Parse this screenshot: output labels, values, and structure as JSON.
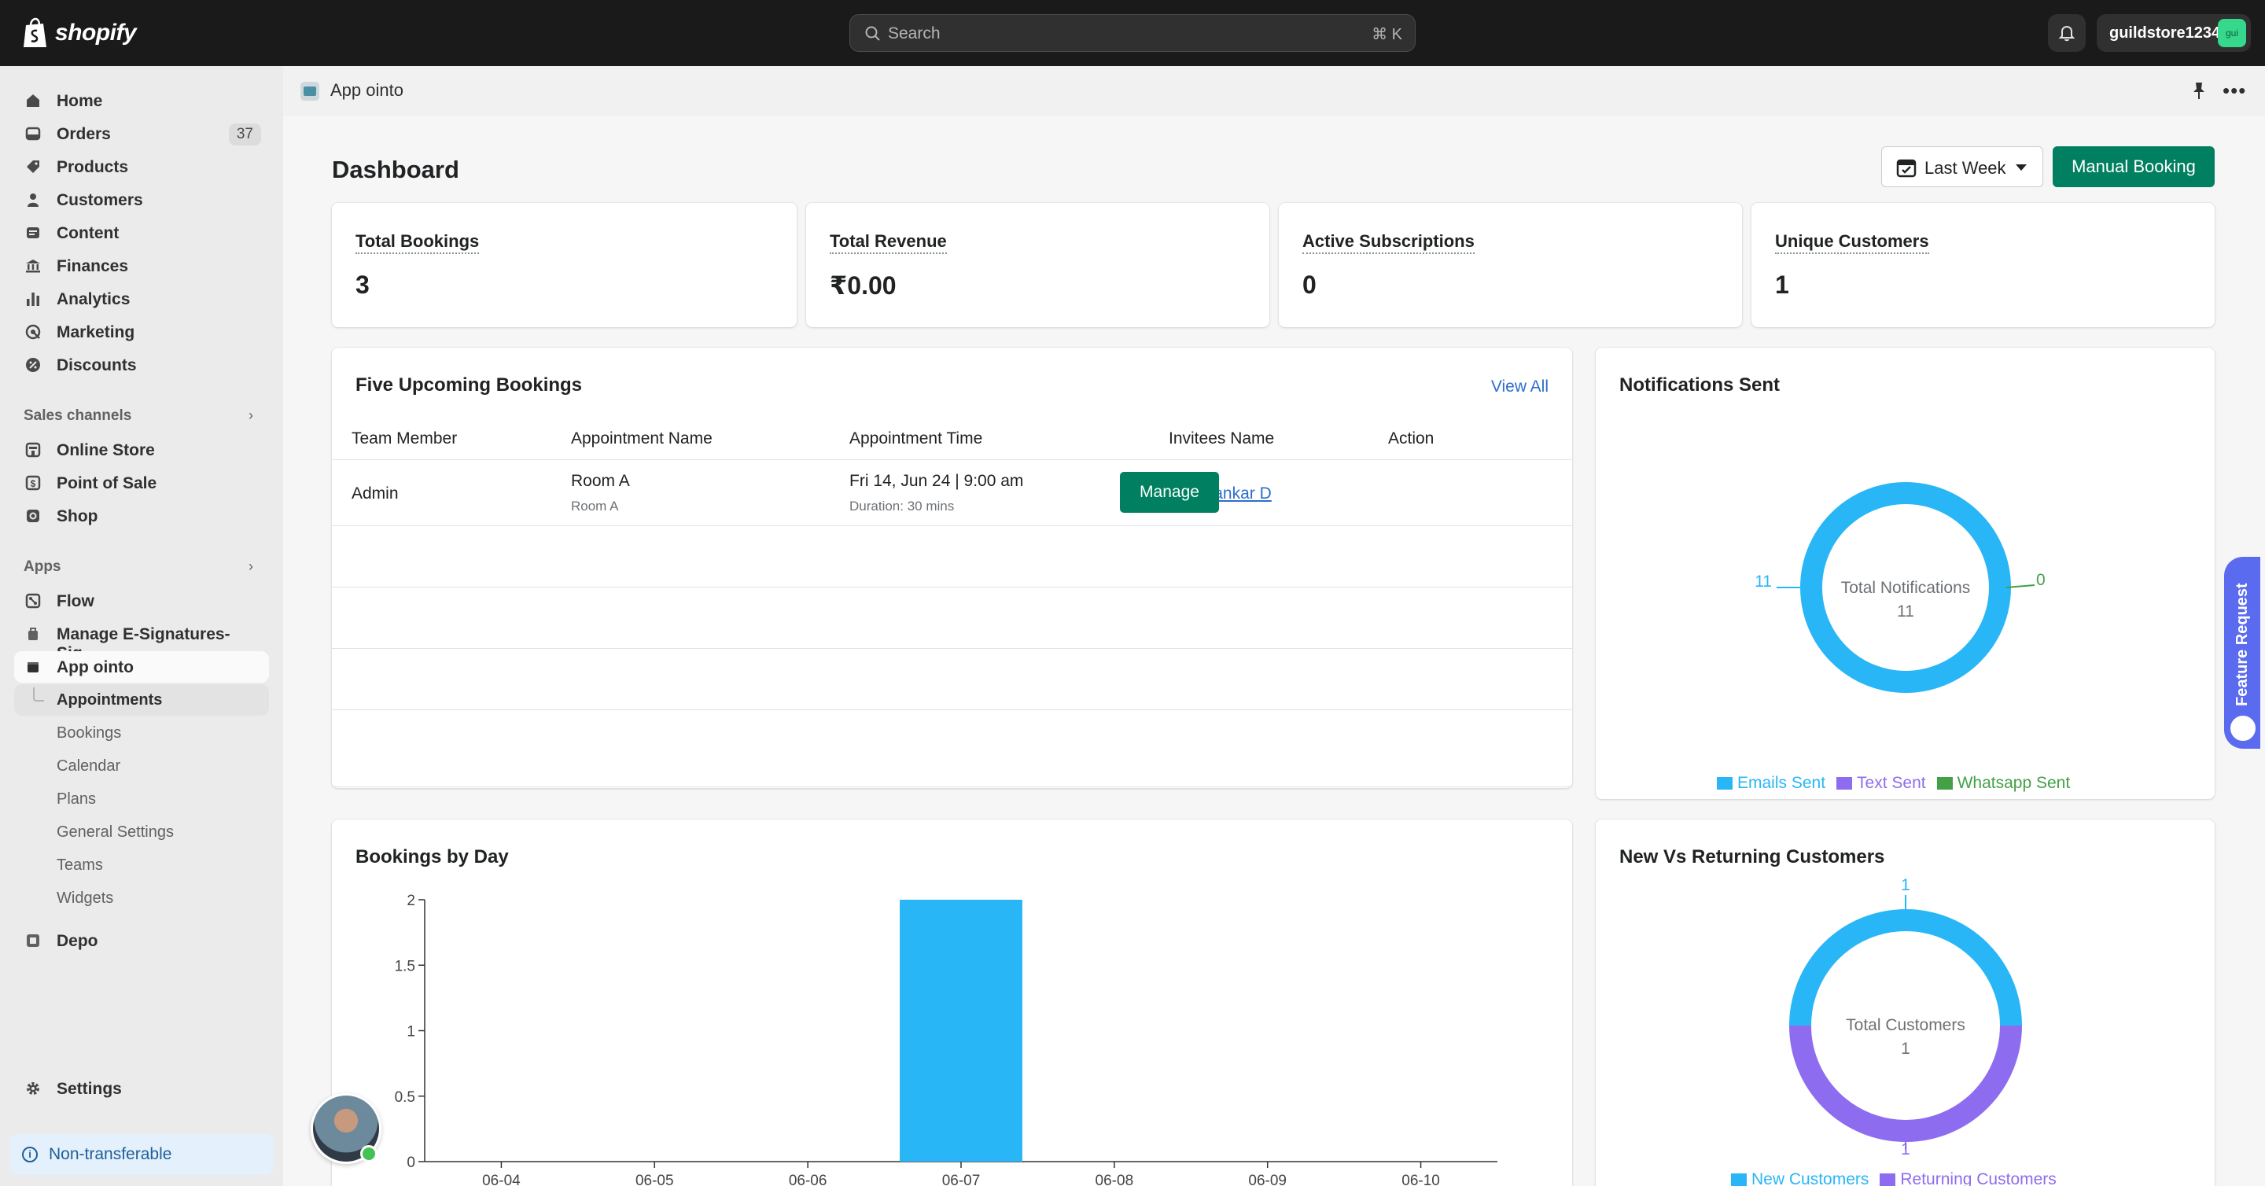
{
  "topbar": {
    "brand": "shopify",
    "search_placeholder": "Search",
    "search_shortcut": "⌘ K",
    "store_name": "guildstore1234",
    "store_avatar": "gui"
  },
  "sidebar": {
    "items": [
      {
        "label": "Home"
      },
      {
        "label": "Orders",
        "badge": "37"
      },
      {
        "label": "Products"
      },
      {
        "label": "Customers"
      },
      {
        "label": "Content"
      },
      {
        "label": "Finances"
      },
      {
        "label": "Analytics"
      },
      {
        "label": "Marketing"
      },
      {
        "label": "Discounts"
      }
    ],
    "sales_channels_label": "Sales channels",
    "channels": [
      {
        "label": "Online Store"
      },
      {
        "label": "Point of Sale"
      },
      {
        "label": "Shop"
      }
    ],
    "apps_label": "Apps",
    "apps": [
      {
        "label": "Flow"
      },
      {
        "label": "Manage E-Signatures-Sig..."
      },
      {
        "label": "App ointo"
      }
    ],
    "app_sub": [
      {
        "label": "Appointments"
      },
      {
        "label": "Bookings"
      },
      {
        "label": "Calendar"
      },
      {
        "label": "Plans"
      },
      {
        "label": "General Settings"
      },
      {
        "label": "Teams"
      },
      {
        "label": "Widgets"
      }
    ],
    "depo": "Depo",
    "settings": "Settings",
    "non_transferable": "Non-transferable"
  },
  "app_header": {
    "title": "App ointo"
  },
  "dashboard": {
    "title": "Dashboard",
    "range_label": "Last Week",
    "manual_booking": "Manual Booking",
    "stats": [
      {
        "label": "Total Bookings",
        "value": "3"
      },
      {
        "label": "Total Revenue",
        "value": "₹0.00"
      },
      {
        "label": "Active Subscriptions",
        "value": "0"
      },
      {
        "label": "Unique Customers",
        "value": "1"
      }
    ]
  },
  "upcoming": {
    "title": "Five Upcoming Bookings",
    "view_all": "View All",
    "headers": [
      "Team Member",
      "Appointment Name",
      "Appointment Time",
      "Invitees Name",
      "Action"
    ],
    "rows": [
      {
        "team_member": "Admin",
        "appointment_name": "Room A",
        "appointment_sub": "Room A",
        "time": "Fri 14, Jun 24 | 9:00 am",
        "duration": "Duration: 30 mins",
        "invitee": "shubhankar D",
        "action": "Manage"
      }
    ]
  },
  "notifications": {
    "title": "Notifications Sent",
    "center_label": "Total Notifications",
    "center_value": "11",
    "label_left": "11",
    "label_right": "0",
    "legend": [
      {
        "name": "Emails Sent",
        "color": "#29b6f6"
      },
      {
        "name": "Text Sent",
        "color": "#8e6cf0"
      },
      {
        "name": "Whatsapp Sent",
        "color": "#43a047"
      }
    ]
  },
  "bookings_by_day_title": "Bookings by Day",
  "new_returning": {
    "title": "New Vs Returning Customers",
    "center_label": "Total Customers",
    "center_value": "1",
    "label_top": "1",
    "label_bottom": "1",
    "legend": [
      {
        "name": "New Customers",
        "color": "#29b6f6"
      },
      {
        "name": "Returning Customers",
        "color": "#8e6cf0"
      }
    ]
  },
  "feature_request": "Feature Request",
  "chart_data": [
    {
      "type": "bar",
      "title": "Bookings by Day",
      "categories": [
        "06-04",
        "06-05",
        "06-06",
        "06-07",
        "06-08",
        "06-09",
        "06-10"
      ],
      "values": [
        0,
        0,
        0,
        2,
        0,
        0,
        0
      ],
      "yticks": [
        "0",
        "0.5",
        "1",
        "1.5",
        "2"
      ],
      "ylim": [
        0,
        2
      ],
      "color": "#29b6f6"
    },
    {
      "type": "pie",
      "title": "Notifications Sent",
      "labels": [
        "Emails Sent",
        "Text Sent",
        "Whatsapp Sent"
      ],
      "values": [
        11,
        0,
        0
      ]
    },
    {
      "type": "pie",
      "title": "New Vs Returning Customers",
      "labels": [
        "New Customers",
        "Returning Customers"
      ],
      "values": [
        1,
        1
      ]
    }
  ]
}
